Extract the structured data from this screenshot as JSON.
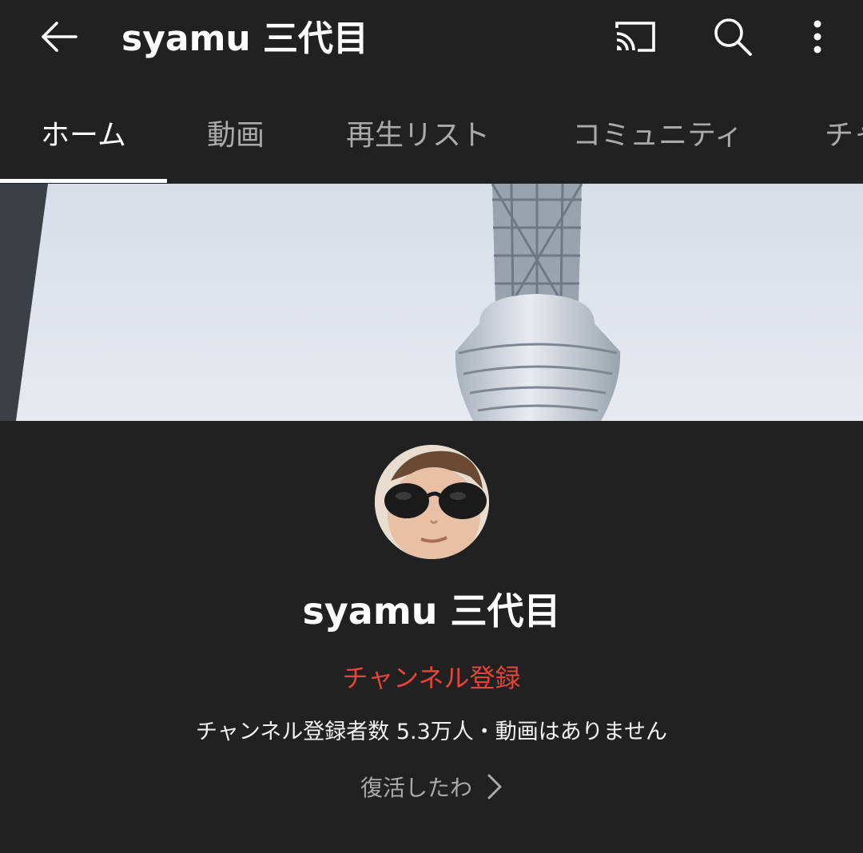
{
  "topbar": {
    "title": "syamu 三代目",
    "back_icon": "arrow-left-icon",
    "cast_icon": "cast-icon",
    "search_icon": "search-icon",
    "more_icon": "more-vert-icon"
  },
  "tabs": [
    {
      "label": "ホーム",
      "active": true
    },
    {
      "label": "動画",
      "active": false
    },
    {
      "label": "再生リスト",
      "active": false
    },
    {
      "label": "コミュニティ",
      "active": false
    },
    {
      "label": "チャ",
      "active": false
    }
  ],
  "channel": {
    "name": "syamu 三代目",
    "subscribe_label": "チャンネル登録",
    "stats": "チャンネル登録者数 5.3万人・動画はありません",
    "about": "復活したわ"
  },
  "colors": {
    "background": "#212121",
    "subscribe": "#e64438",
    "tab_inactive": "#aaaaaa",
    "text": "#ffffff"
  }
}
